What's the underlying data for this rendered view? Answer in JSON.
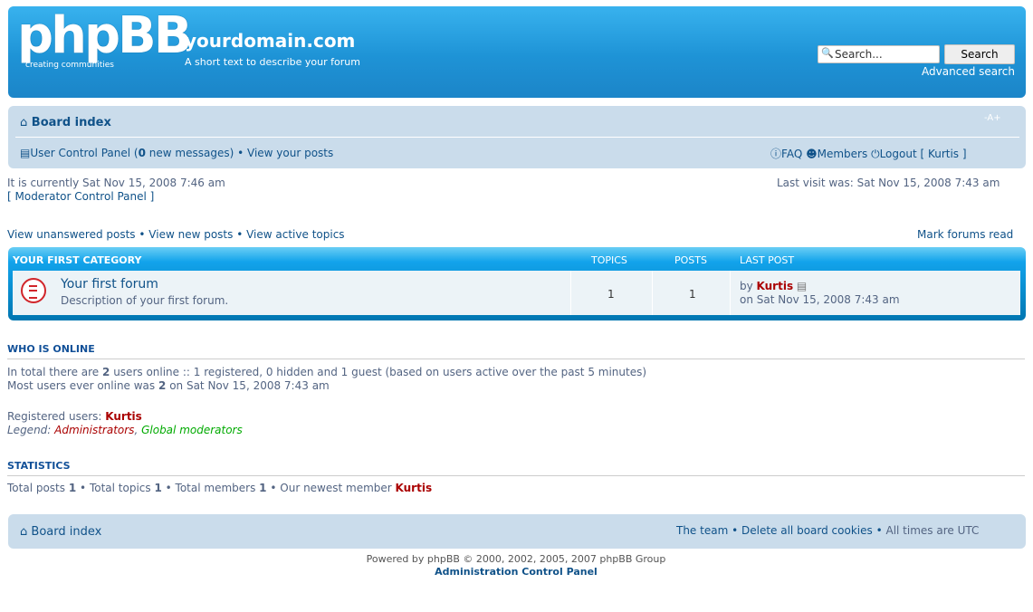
{
  "header": {
    "logo_text": "phpBB",
    "logo_tagline": "creating communities",
    "site_title": "yourdomain.com",
    "site_description": "A short text to describe your forum",
    "search_placeholder": "Search...",
    "search_button": "Search",
    "advanced_search": "Advanced search"
  },
  "navbar": {
    "board_index": "Board index",
    "font_size": "-A+",
    "ucp": "User Control Panel",
    "new_messages_open": "(",
    "new_messages_count": "0",
    "new_messages_close": "new messages)",
    "separator": "•",
    "view_your_posts": "View your posts",
    "faq": "FAQ",
    "members": "Members",
    "logout": "Logout [ Kurtis ]"
  },
  "status": {
    "current_time": "It is currently Sat Nov 15, 2008 7:46 am",
    "mcp": "[ Moderator Control Panel ]",
    "last_visit": "Last visit was: Sat Nov 15, 2008 7:43 am"
  },
  "quicklinks": {
    "unanswered": "View unanswered posts",
    "new_posts": "View new posts",
    "active": "View active topics",
    "mark_read": "Mark forums read"
  },
  "forum_table": {
    "category": "YOUR FIRST CATEGORY",
    "col_topics": "TOPICS",
    "col_posts": "POSTS",
    "col_last_post": "LAST POST",
    "forum_title": "Your first forum",
    "forum_desc": "Description of your first forum.",
    "topics": "1",
    "posts": "1",
    "last_post_by": "by",
    "last_post_user": "Kurtis",
    "last_post_time": "on Sat Nov 15, 2008 7:43 am"
  },
  "who_is_online": {
    "heading": "WHO IS ONLINE",
    "line1_a": "In total there are",
    "line1_count": "2",
    "line1_b": "users online :: 1 registered, 0 hidden and 1 guest (based on users active over the past 5 minutes)",
    "line2_a": "Most users ever online was",
    "line2_count": "2",
    "line2_b": "on Sat Nov 15, 2008 7:43 am",
    "registered_label": "Registered users:",
    "registered_user": "Kurtis",
    "legend_label": "Legend:",
    "legend_admin": "Administrators",
    "legend_gmod": "Global moderators"
  },
  "statistics": {
    "heading": "STATISTICS",
    "total_posts_label": "Total posts",
    "total_posts": "1",
    "total_topics_label": "Total topics",
    "total_topics": "1",
    "total_members_label": "Total members",
    "total_members": "1",
    "newest_label": "Our newest member",
    "newest_member": "Kurtis"
  },
  "footer": {
    "board_index": "Board index",
    "the_team": "The team",
    "delete_cookies": "Delete all board cookies",
    "times": "All times are UTC",
    "powered": "Powered by phpBB © 2000, 2002, 2005, 2007 phpBB Group",
    "acp": "Administration Control Panel"
  }
}
